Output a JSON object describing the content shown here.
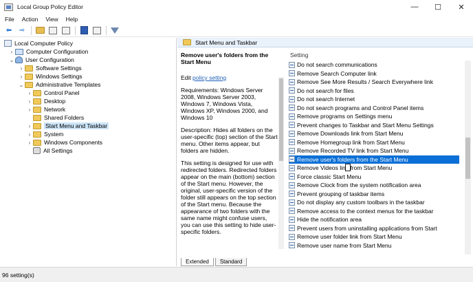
{
  "window": {
    "title": "Local Group Policy Editor",
    "minimize": "—",
    "maximize": "☐",
    "close": "✕"
  },
  "menu": [
    "File",
    "Action",
    "View",
    "Help"
  ],
  "toolbar": {
    "back": "⬅",
    "forward": "➡"
  },
  "tree": [
    {
      "label": "Local Computer Policy",
      "icon": "computer-policy-icon",
      "expander": ""
    },
    {
      "label": "Computer Configuration",
      "icon": "computer-icon",
      "expander": "›"
    },
    {
      "label": "User Configuration",
      "icon": "user-icon",
      "expander": "⌄"
    },
    {
      "label": "Software Settings",
      "icon": "folder-icon",
      "expander": "›"
    },
    {
      "label": "Windows Settings",
      "icon": "folder-icon",
      "expander": "›"
    },
    {
      "label": "Administrative Templates",
      "icon": "folder-icon",
      "expander": "⌄"
    },
    {
      "label": "Control Panel",
      "icon": "folder-icon",
      "expander": "›"
    },
    {
      "label": "Desktop",
      "icon": "folder-icon",
      "expander": "›"
    },
    {
      "label": "Network",
      "icon": "folder-icon",
      "expander": "›"
    },
    {
      "label": "Shared Folders",
      "icon": "folder-icon",
      "expander": ""
    },
    {
      "label": "Start Menu and Taskbar",
      "icon": "folder-icon",
      "expander": "›"
    },
    {
      "label": "System",
      "icon": "folder-icon",
      "expander": "›"
    },
    {
      "label": "Windows Components",
      "icon": "folder-icon",
      "expander": "›"
    },
    {
      "label": "All Settings",
      "icon": "all-settings-icon",
      "expander": ""
    }
  ],
  "right_header": "Start Menu and Taskbar",
  "description": {
    "title": "Remove user's folders from the Start Menu",
    "edit_prefix": "Edit ",
    "edit_link": "policy setting",
    "requirements": "Requirements: Windows Server 2008, Windows Server 2003, Windows 7, Windows Vista, Windows XP, Windows 2000, and Windows 10",
    "desc": "Description: Hides all folders on the user-specific (top) section of the Start menu. Other items appear, but folders are hidden.",
    "note": "This setting is designed for use with redirected folders. Redirected folders appear on the main (bottom) section of the Start menu. However, the original, user-specific version of the folder still appears on the top section of the Start menu. Because the appearance of two folders with the same name might confuse users, you can use this setting to hide user-specific folders."
  },
  "list_header": "Setting",
  "settings": [
    "Do not search communications",
    "Remove Search Computer link",
    "Remove See More Results / Search Everywhere link",
    "Do not search for files",
    "Do not search Internet",
    "Do not search programs and Control Panel items",
    "Remove programs on Settings menu",
    "Prevent changes to Taskbar and Start Menu Settings",
    "Remove Downloads link from Start Menu",
    "Remove Homegroup link from Start Menu",
    "Remove Recorded TV link from Start Menu",
    "Remove user's folders from the Start Menu",
    "Remove Videos link from Start Menu",
    "Force classic Start Menu",
    "Remove Clock from the system notification area",
    "Prevent grouping of taskbar items",
    "Do not display any custom toolbars in the taskbar",
    "Remove access to the context menus for the taskbar",
    "Hide the notification area",
    "Prevent users from uninstalling applications from Start",
    "Remove user folder link from Start Menu",
    "Remove user name from Start Menu"
  ],
  "selected_setting_index": 11,
  "tabs": [
    "Extended",
    "Standard"
  ],
  "status": "96 setting(s)"
}
